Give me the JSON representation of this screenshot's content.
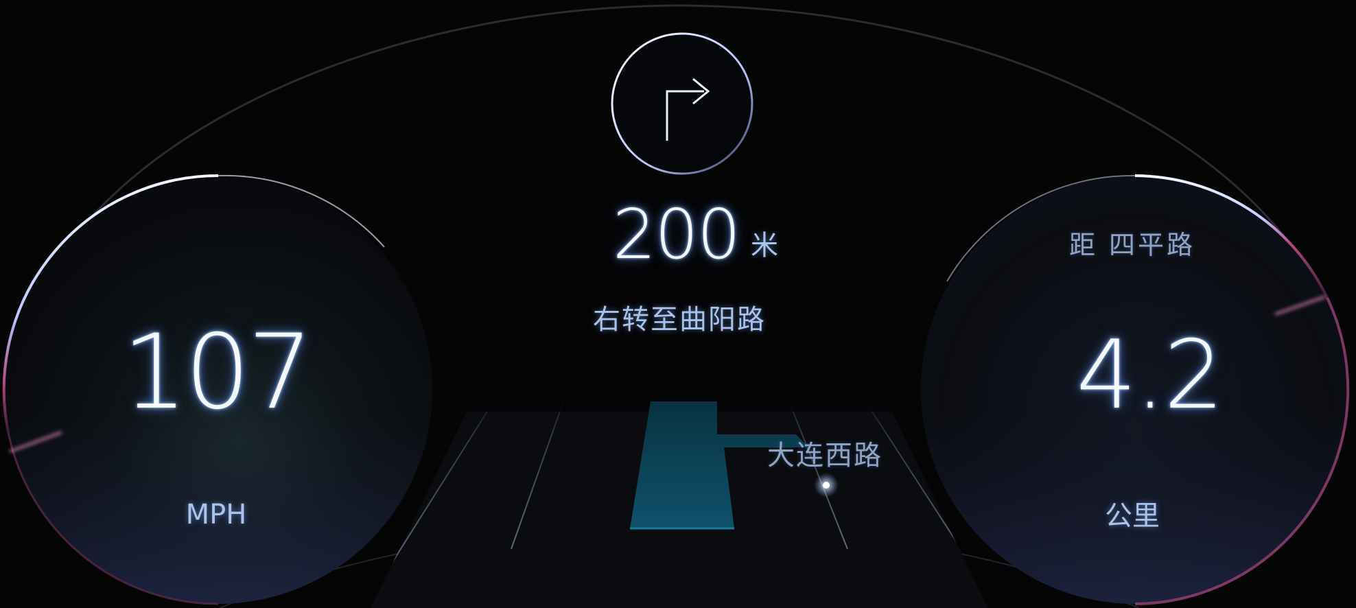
{
  "colors": {
    "background": "#050506",
    "glow_blue": "#9fc2ff",
    "accent_magenta": "#b0407a",
    "route_fill": "#0c4a60",
    "text_soft": "#a9c3ea"
  },
  "navigation": {
    "turn_icon": "turn-right-icon",
    "distance": {
      "value": "200",
      "unit": "米"
    },
    "instruction": "右转至曲阳路",
    "map": {
      "street_label": "大连西路"
    }
  },
  "speed_gauge": {
    "value": "107",
    "unit": "MPH"
  },
  "distance_gauge": {
    "label": "距 四平路",
    "value": "4.2",
    "unit": "公里"
  }
}
